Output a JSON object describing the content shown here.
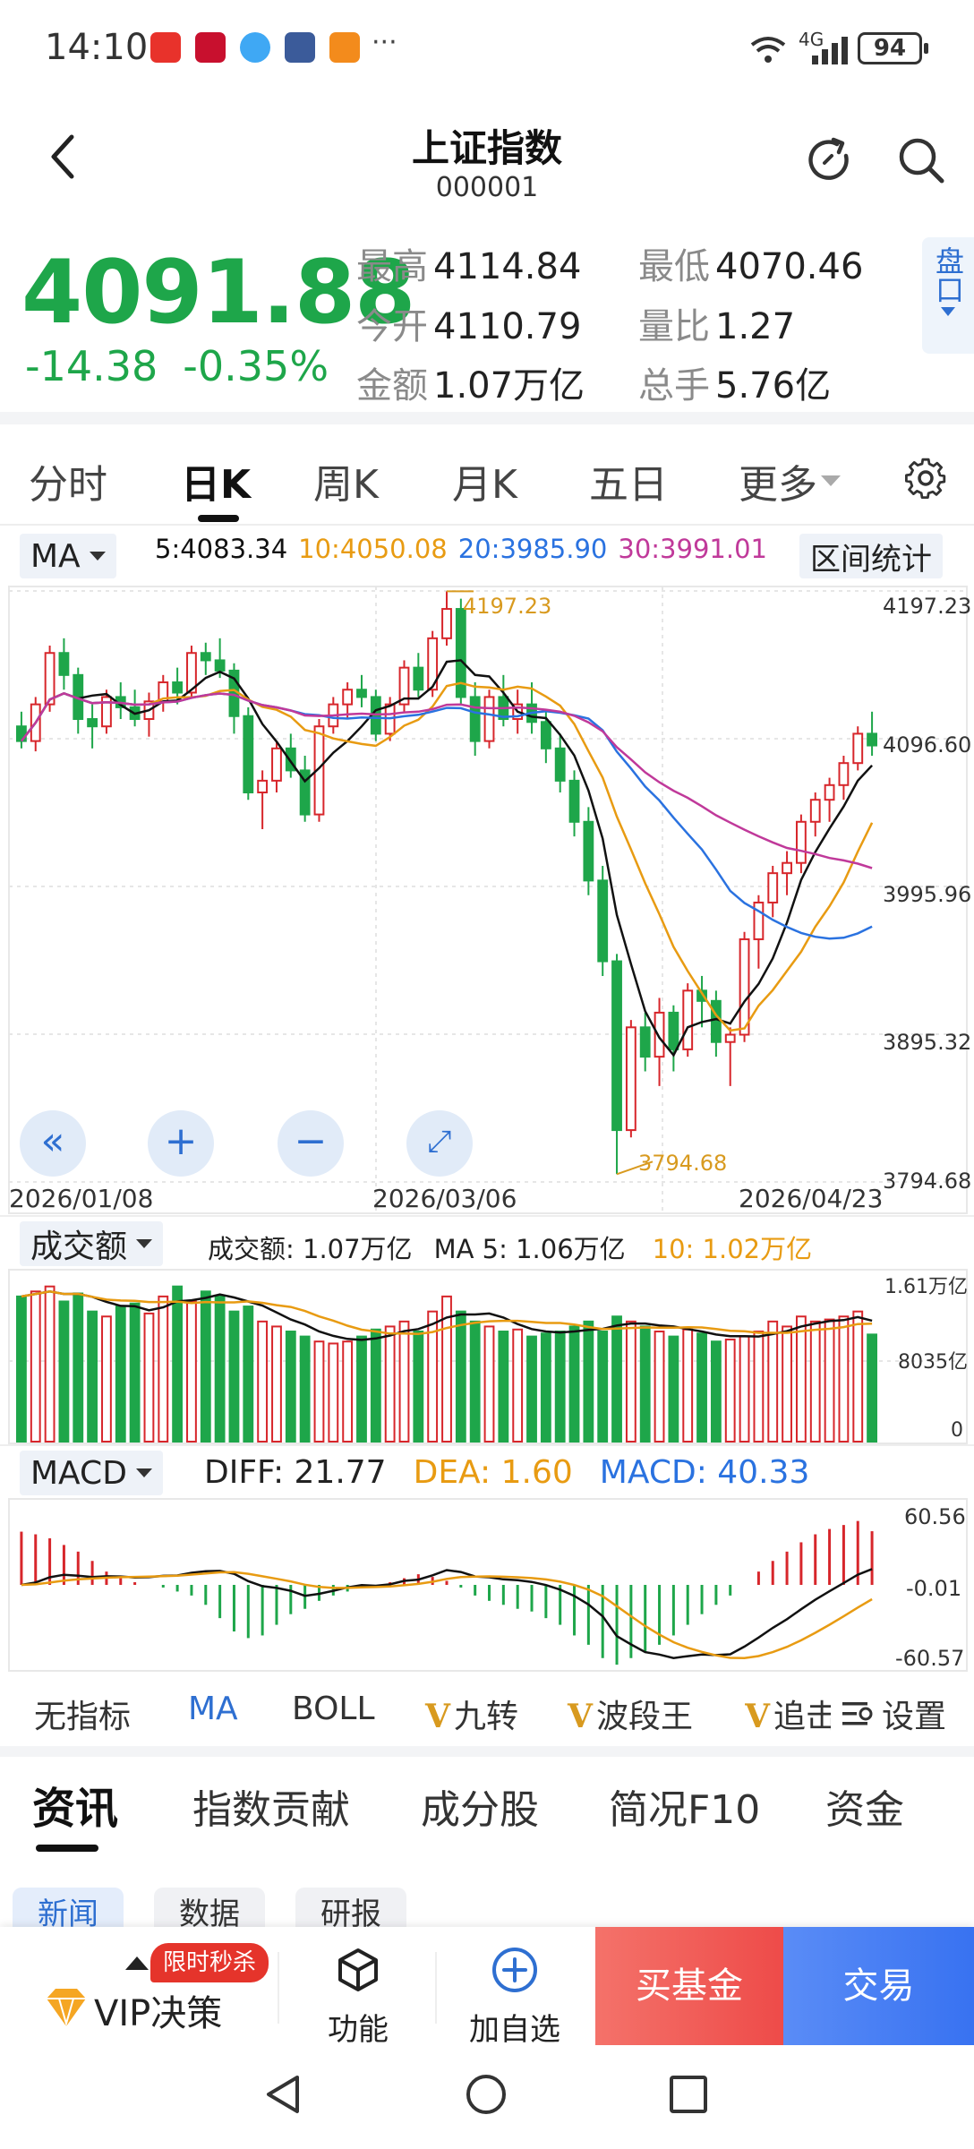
{
  "status_bar": {
    "time": "14:10",
    "network": "4G",
    "battery": "94",
    "app_icon_colors": [
      "#e8322b",
      "#c8102e",
      "#3fa8f4",
      "#3b5b9a",
      "#f38b1c"
    ]
  },
  "header": {
    "title": "上证指数",
    "code": "000001"
  },
  "quote": {
    "price": "4091.88",
    "change": "-14.38",
    "change_pct": "-0.35%",
    "stats": [
      {
        "label": "最高",
        "value": "4114.84"
      },
      {
        "label": "最低",
        "value": "4070.46"
      },
      {
        "label": "今开",
        "value": "4110.79"
      },
      {
        "label": "量比",
        "value": "1.27"
      },
      {
        "label": "金额",
        "value": "1.07万亿"
      },
      {
        "label": "总手",
        "value": "5.76亿"
      }
    ],
    "pankou": "盘口",
    "down_color": "#1ea64a",
    "up_color": "#d7262b"
  },
  "period_tabs": [
    "分时",
    "日K",
    "周K",
    "月K",
    "五日",
    "更多"
  ],
  "active_period": "日K",
  "ma_legend": {
    "selector": "MA",
    "ma5": "5:4083.34",
    "ma10": "10:4050.08",
    "ma20": "20:3985.90",
    "ma30": "30:3991.01",
    "interval_button": "区间统计",
    "colors": {
      "ma5": "#111111",
      "ma10": "#e89b12",
      "ma20": "#2a72e0",
      "ma30": "#c0399a"
    }
  },
  "kline": {
    "y_labels": [
      "4197.23",
      "4096.60",
      "3995.96",
      "3895.32",
      "3794.68"
    ],
    "high_marker": "4197.23",
    "low_marker": "3794.68",
    "dates": [
      "2026/01/08",
      "2026/03/06",
      "2026/04/23"
    ]
  },
  "volume": {
    "selector": "成交额",
    "legend_amount": "成交额: 1.07万亿",
    "legend_ma5": "MA 5: 1.06万亿",
    "legend_ma10": "10: 1.02万亿",
    "y_labels": [
      "1.61万亿",
      "8035亿",
      "0"
    ]
  },
  "macd": {
    "selector": "MACD",
    "diff": "DIFF: 21.77",
    "dea": "DEA: 1.60",
    "macd": "MACD: 40.33",
    "y_labels": [
      "60.56",
      "-0.01",
      "-60.57"
    ]
  },
  "indicators": [
    "无指标",
    "MA",
    "BOLL",
    "九转",
    "波段王",
    "追击"
  ],
  "indicator_settings": "设置",
  "info_tabs": [
    "资讯",
    "指数贡献",
    "成分股",
    "简况F10",
    "资金"
  ],
  "info_chips": [
    "新闻",
    "数据",
    "研报"
  ],
  "bottom_bar": {
    "flash_sale": "限时秒杀",
    "vip": "VIP决策",
    "features": "功能",
    "add_watch": "加自选",
    "buy_fund": "买基金",
    "trade": "交易"
  },
  "chart_data": [
    {
      "type": "candlestick",
      "title": "日K",
      "x_start": "2026/01/08",
      "x_mid": "2026/03/06",
      "x_end": "2026/04/23",
      "ylim": [
        3794.68,
        4197.23
      ],
      "ohlc": [
        [
          4105,
          4115,
          4090,
          4095
        ],
        [
          4095,
          4125,
          4088,
          4120
        ],
        [
          4120,
          4160,
          4115,
          4155
        ],
        [
          4155,
          4165,
          4130,
          4140
        ],
        [
          4140,
          4145,
          4100,
          4110
        ],
        [
          4110,
          4120,
          4090,
          4105
        ],
        [
          4105,
          4130,
          4100,
          4125
        ],
        [
          4125,
          4135,
          4110,
          4118
        ],
        [
          4118,
          4130,
          4105,
          4110
        ],
        [
          4110,
          4128,
          4098,
          4122
        ],
        [
          4122,
          4140,
          4115,
          4135
        ],
        [
          4135,
          4145,
          4120,
          4128
        ],
        [
          4128,
          4160,
          4125,
          4155
        ],
        [
          4155,
          4162,
          4140,
          4150
        ],
        [
          4150,
          4165,
          4138,
          4143
        ],
        [
          4143,
          4148,
          4100,
          4112
        ],
        [
          4112,
          4118,
          4055,
          4060
        ],
        [
          4060,
          4075,
          4035,
          4068
        ],
        [
          4068,
          4095,
          4060,
          4090
        ],
        [
          4090,
          4100,
          4070,
          4075
        ],
        [
          4075,
          4085,
          4040,
          4045
        ],
        [
          4045,
          4110,
          4040,
          4105
        ],
        [
          4105,
          4125,
          4100,
          4120
        ],
        [
          4120,
          4135,
          4110,
          4130
        ],
        [
          4130,
          4140,
          4118,
          4125
        ],
        [
          4125,
          4130,
          4095,
          4100
        ],
        [
          4100,
          4125,
          4095,
          4120
        ],
        [
          4120,
          4150,
          4115,
          4145
        ],
        [
          4145,
          4155,
          4125,
          4130
        ],
        [
          4130,
          4170,
          4125,
          4165
        ],
        [
          4165,
          4197,
          4160,
          4185
        ],
        [
          4185,
          4192,
          4120,
          4125
        ],
        [
          4125,
          4135,
          4085,
          4095
        ],
        [
          4095,
          4130,
          4090,
          4125
        ],
        [
          4125,
          4140,
          4105,
          4110
        ],
        [
          4110,
          4130,
          4100,
          4120
        ],
        [
          4120,
          4135,
          4100,
          4108
        ],
        [
          4108,
          4115,
          4080,
          4090
        ],
        [
          4090,
          4100,
          4060,
          4068
        ],
        [
          4068,
          4075,
          4030,
          4040
        ],
        [
          4040,
          4050,
          3990,
          4000
        ],
        [
          4000,
          4010,
          3935,
          3945
        ],
        [
          3945,
          3950,
          3800,
          3830
        ],
        [
          3830,
          3905,
          3825,
          3900
        ],
        [
          3900,
          3910,
          3870,
          3880
        ],
        [
          3880,
          3920,
          3860,
          3910
        ],
        [
          3910,
          3915,
          3870,
          3885
        ],
        [
          3885,
          3930,
          3880,
          3925
        ],
        [
          3925,
          3935,
          3900,
          3918
        ],
        [
          3918,
          3925,
          3880,
          3890
        ],
        [
          3890,
          3900,
          3860,
          3895
        ],
        [
          3895,
          3965,
          3890,
          3960
        ],
        [
          3960,
          3990,
          3940,
          3985
        ],
        [
          3985,
          4010,
          3975,
          4005
        ],
        [
          4005,
          4020,
          3990,
          4012
        ],
        [
          4012,
          4045,
          4005,
          4040
        ],
        [
          4040,
          4060,
          4030,
          4055
        ],
        [
          4055,
          4070,
          4040,
          4065
        ],
        [
          4065,
          4085,
          4055,
          4080
        ],
        [
          4080,
          4105,
          4075,
          4100
        ],
        [
          4100,
          4115,
          4085,
          4092
        ]
      ],
      "ma5": "4083.34",
      "ma10": "4050.08",
      "ma20": "3985.90",
      "ma30": "3991.01"
    },
    {
      "type": "bar",
      "title": "成交额",
      "ylabel": "万亿",
      "ylim": [
        0,
        1.61
      ],
      "values": [
        1.45,
        1.5,
        1.55,
        1.4,
        1.48,
        1.3,
        1.25,
        1.35,
        1.38,
        1.28,
        1.45,
        1.55,
        1.4,
        1.5,
        1.45,
        1.3,
        1.35,
        1.2,
        1.15,
        1.1,
        1.05,
        1.0,
        0.98,
        1.0,
        1.05,
        1.12,
        1.15,
        1.2,
        1.1,
        1.3,
        1.45,
        1.3,
        1.2,
        1.15,
        1.1,
        1.12,
        1.05,
        1.08,
        1.1,
        1.15,
        1.2,
        1.1,
        1.25,
        1.2,
        1.15,
        1.1,
        1.05,
        1.12,
        1.08,
        1.0,
        1.02,
        1.05,
        1.1,
        1.2,
        1.15,
        1.25,
        1.2,
        1.22,
        1.25,
        1.3,
        1.07
      ]
    },
    {
      "type": "bar",
      "title": "MACD",
      "ylim": [
        -60.57,
        60.56
      ],
      "diff": "21.77",
      "dea": "1.60",
      "macd": "40.33",
      "values": [
        40,
        38,
        35,
        30,
        25,
        18,
        10,
        5,
        2,
        0,
        -2,
        -5,
        -8,
        -15,
        -25,
        -35,
        -40,
        -38,
        -30,
        -22,
        -18,
        -12,
        -8,
        -5,
        -2,
        0,
        2,
        5,
        8,
        6,
        3,
        -2,
        -8,
        -12,
        -15,
        -18,
        -20,
        -25,
        -30,
        -38,
        -45,
        -55,
        -60,
        -55,
        -50,
        -45,
        -38,
        -30,
        -22,
        -15,
        -8,
        0,
        10,
        18,
        25,
        32,
        38,
        42,
        45,
        48,
        40.33
      ]
    }
  ]
}
